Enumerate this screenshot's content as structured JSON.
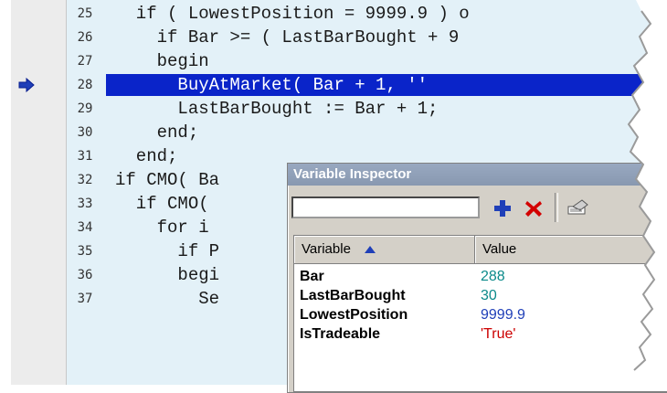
{
  "editor": {
    "lines": [
      {
        "num": "25",
        "code": "  if ( LowestPosition = 9999.9 ) o"
      },
      {
        "num": "26",
        "code": "    if Bar >= ( LastBarBought + 9"
      },
      {
        "num": "27",
        "code": "    begin"
      },
      {
        "num": "28",
        "code": "      BuyAtMarket( Bar + 1, ''"
      },
      {
        "num": "29",
        "code": "      LastBarBought := Bar + 1;"
      },
      {
        "num": "30",
        "code": "    end;"
      },
      {
        "num": "31",
        "code": "  end;"
      },
      {
        "num": "32",
        "code": "if CMO( Ba"
      },
      {
        "num": "33",
        "code": "  if CMO("
      },
      {
        "num": "34",
        "code": "    for i"
      },
      {
        "num": "35",
        "code": "      if P"
      },
      {
        "num": "36",
        "code": "      begi"
      },
      {
        "num": "37",
        "code": "        Se"
      }
    ],
    "current_line": "28",
    "colors": {
      "highlight": "#0a24c9",
      "background": "#e3f1f8",
      "number": "#0b8a8a",
      "function": "#1f3fb8"
    }
  },
  "inspector": {
    "title": "Variable Inspector",
    "input_value": "",
    "add_icon": "plus-icon",
    "remove_icon": "red-x-icon",
    "tool_icon": "eraser-icon",
    "columns": {
      "variable": "Variable",
      "value": "Value"
    },
    "rows": [
      {
        "name": "Bar",
        "value": "288",
        "color": "#0b8a8a"
      },
      {
        "name": "LastBarBought",
        "value": "30",
        "color": "#0b8a8a"
      },
      {
        "name": "LowestPosition",
        "value": "9999.9",
        "color": "#1f3fb8"
      },
      {
        "name": "IsTradeable",
        "value": "'True'",
        "color": "#cc0000"
      }
    ]
  }
}
